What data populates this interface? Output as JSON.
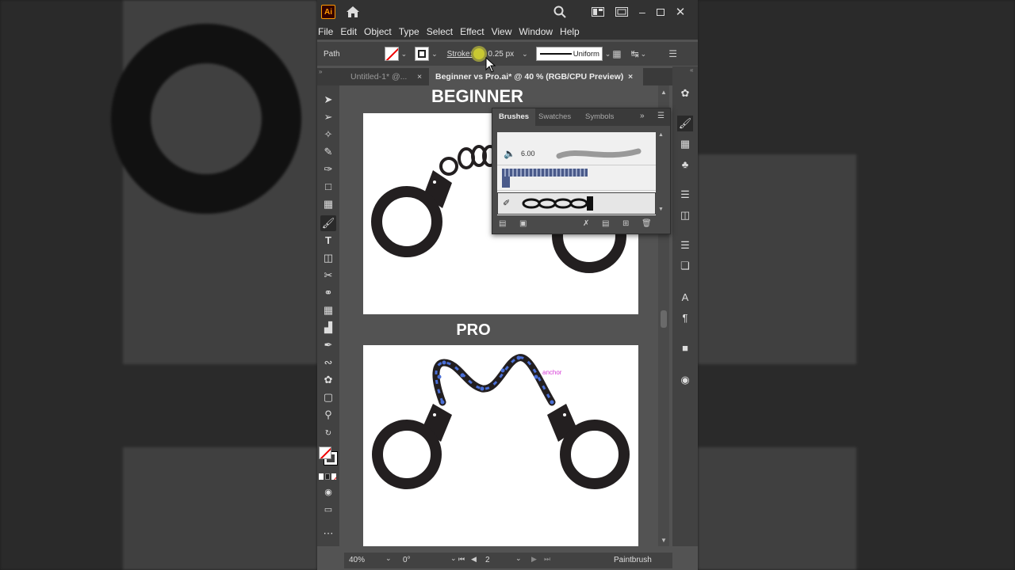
{
  "menu": [
    "File",
    "Edit",
    "Object",
    "Type",
    "Select",
    "Effect",
    "View",
    "Window",
    "Help"
  ],
  "control": {
    "selection": "Path",
    "stroke_label": "Stroke:",
    "stroke_value": "0.25 px",
    "profile": "Uniform"
  },
  "tabs": [
    {
      "label": "Untitled-1* @..."
    },
    {
      "label": "Beginner vs Pro.ai* @ 40 % (RGB/CPU Preview)"
    }
  ],
  "canvas": {
    "heading_top": "BEGINNER",
    "heading_bottom": "PRO",
    "anchor_label": "anchor"
  },
  "brushes_panel": {
    "tabs": [
      "Brushes",
      "Swatches",
      "Symbols"
    ],
    "brush_size": "6.00"
  },
  "status": {
    "zoom": "40%",
    "rotation": "0°",
    "artboard": "2",
    "tool": "Paintbrush"
  },
  "colors": {
    "accent": "#ff9a00",
    "chain_highlight": "#4a6fd6",
    "anchor_text": "#d63ad6"
  }
}
